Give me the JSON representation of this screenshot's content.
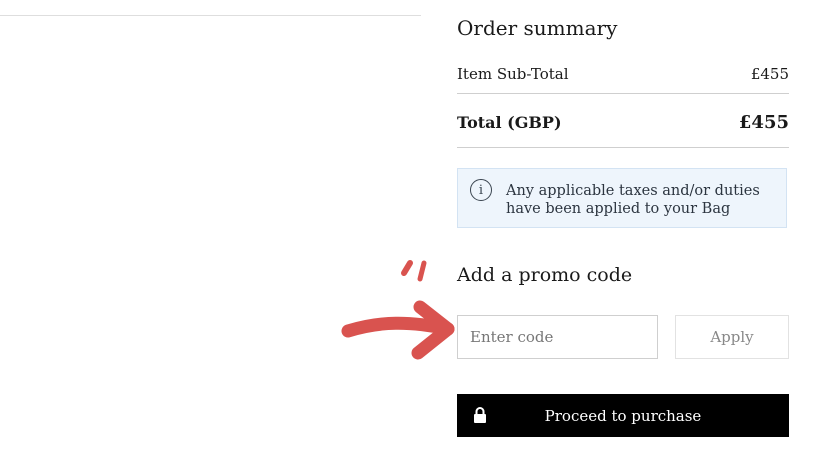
{
  "summary": {
    "title": "Order summary",
    "subtotal_label": "Item Sub-Total",
    "subtotal_value": "£455",
    "total_label": "Total (GBP)",
    "total_value": "£455"
  },
  "notice": {
    "icon": "info-icon",
    "text": "Any applicable taxes and/or duties have been applied to your Bag"
  },
  "promo": {
    "title": "Add a promo code",
    "placeholder": "Enter code",
    "apply_label": "Apply"
  },
  "purchase": {
    "label": "Proceed to purchase",
    "icon": "lock-icon"
  },
  "annotation": {
    "icon": "arrow-annotation",
    "color": "#d9534f"
  }
}
